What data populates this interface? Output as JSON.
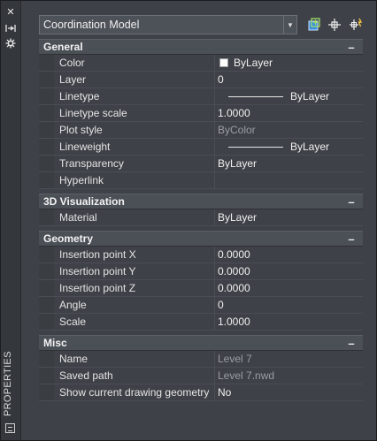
{
  "side_panel": {
    "title": "PROPERTIES"
  },
  "selector": {
    "value": "Coordination Model"
  },
  "sections": [
    {
      "title": "General",
      "rows": [
        {
          "label": "Color",
          "value": "ByLayer",
          "kind": "color"
        },
        {
          "label": "Layer",
          "value": "0"
        },
        {
          "label": "Linetype",
          "value": "ByLayer",
          "kind": "line"
        },
        {
          "label": "Linetype scale",
          "value": "1.0000"
        },
        {
          "label": "Plot style",
          "value": "ByColor",
          "muted": true
        },
        {
          "label": "Lineweight",
          "value": "ByLayer",
          "kind": "line"
        },
        {
          "label": "Transparency",
          "value": "ByLayer"
        },
        {
          "label": "Hyperlink",
          "value": ""
        }
      ]
    },
    {
      "title": "3D Visualization",
      "rows": [
        {
          "label": "Material",
          "value": "ByLayer"
        }
      ]
    },
    {
      "title": "Geometry",
      "rows": [
        {
          "label": "Insertion point X",
          "value": "0.0000"
        },
        {
          "label": "Insertion point Y",
          "value": "0.0000"
        },
        {
          "label": "Insertion point Z",
          "value": "0.0000"
        },
        {
          "label": "Angle",
          "value": "0"
        },
        {
          "label": "Scale",
          "value": "1.0000"
        }
      ]
    },
    {
      "title": "Misc",
      "rows": [
        {
          "label": "Name",
          "value": "Level 7",
          "muted": true
        },
        {
          "label": "Saved path",
          "value": "Level 7.nwd",
          "muted": true
        },
        {
          "label": "Show current drawing geometry",
          "value": "No"
        }
      ]
    }
  ],
  "colors": {
    "background": "#3e4147",
    "header": "#4b4f56",
    "muted_text": "#9a9da2"
  }
}
